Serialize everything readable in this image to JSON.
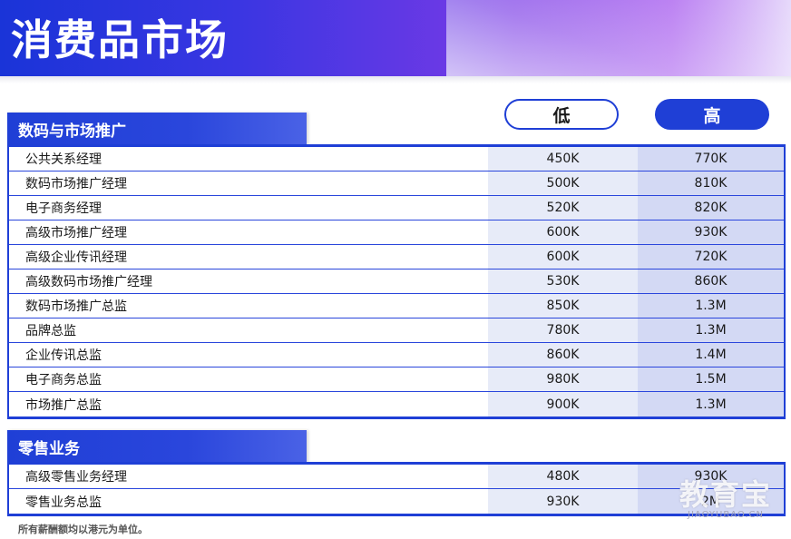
{
  "header": {
    "title": "消费品市场"
  },
  "columns": {
    "low": "低",
    "high": "高"
  },
  "sections": [
    {
      "title": "数码与市场推广",
      "rows": [
        {
          "name": "公共关系经理",
          "low": "450K",
          "high": "770K"
        },
        {
          "name": "数码市场推广经理",
          "low": "500K",
          "high": "810K"
        },
        {
          "name": "电子商务经理",
          "low": "520K",
          "high": "820K"
        },
        {
          "name": "高级市场推广经理",
          "low": "600K",
          "high": "930K"
        },
        {
          "name": "高级企业传讯经理",
          "low": "600K",
          "high": "720K"
        },
        {
          "name": "高级数码市场推广经理",
          "low": "530K",
          "high": "860K"
        },
        {
          "name": "数码市场推广总监",
          "low": "850K",
          "high": "1.3M"
        },
        {
          "name": "品牌总监",
          "low": "780K",
          "high": "1.3M"
        },
        {
          "name": "企业传讯总监",
          "low": "860K",
          "high": "1.4M"
        },
        {
          "name": "电子商务总监",
          "low": "980K",
          "high": "1.5M"
        },
        {
          "name": "市场推广总监",
          "low": "900K",
          "high": "1.3M"
        }
      ]
    },
    {
      "title": "零售业务",
      "rows": [
        {
          "name": "高级零售业务经理",
          "low": "480K",
          "high": "930K"
        },
        {
          "name": "零售业务总监",
          "low": "930K",
          "high": "2M"
        }
      ]
    }
  ],
  "footnote": "所有薪酬额均以港元为单位。",
  "watermark": {
    "main": "教育宝",
    "sub": "JIAOYUBAO.CN"
  }
}
